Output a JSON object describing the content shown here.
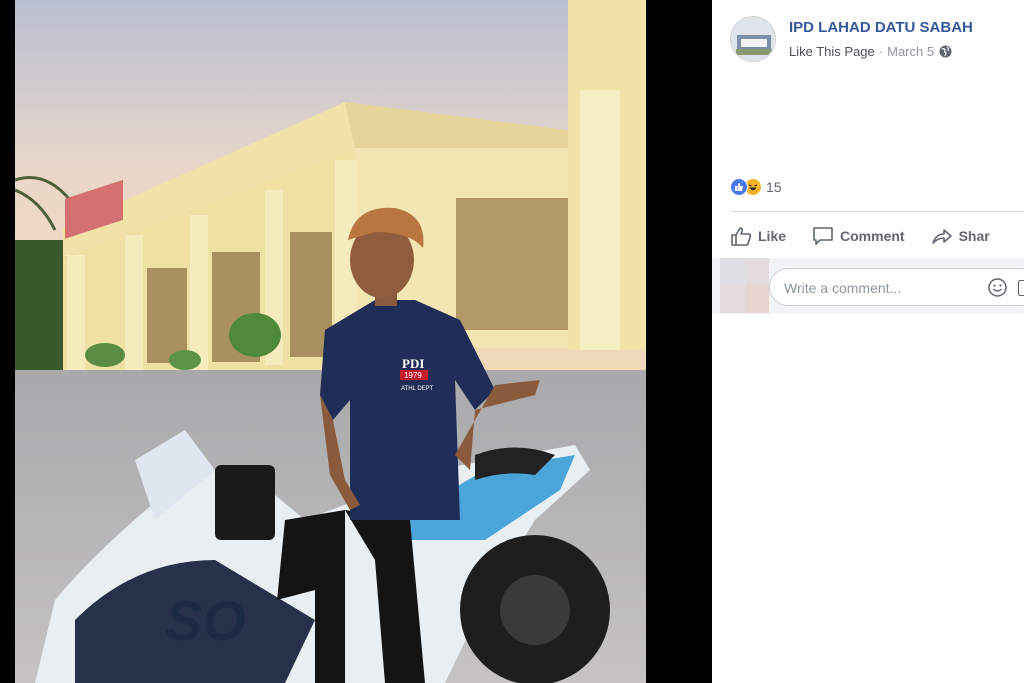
{
  "post": {
    "page_name": "IPD LAHAD DATU SABAH",
    "like_page_label": "Like This Page",
    "separator": "·",
    "date": "March 5",
    "privacy_icon": "globe-icon"
  },
  "photo": {
    "shirt_text": "PDI",
    "shirt_small_text": "1979",
    "shirt_tag": "ATHL DEPT",
    "bike_text": "SO"
  },
  "reactions": {
    "icons": [
      "like-reaction-icon",
      "haha-reaction-icon"
    ],
    "count": "15"
  },
  "actions": {
    "like_label": "Like",
    "comment_label": "Comment",
    "share_label": "Shar"
  },
  "comment": {
    "placeholder": "Write a comment..."
  },
  "colors": {
    "link": "#365899",
    "meta": "#90949c",
    "like_blue": "#4a78f0",
    "haha_yellow": "#f7b125"
  }
}
